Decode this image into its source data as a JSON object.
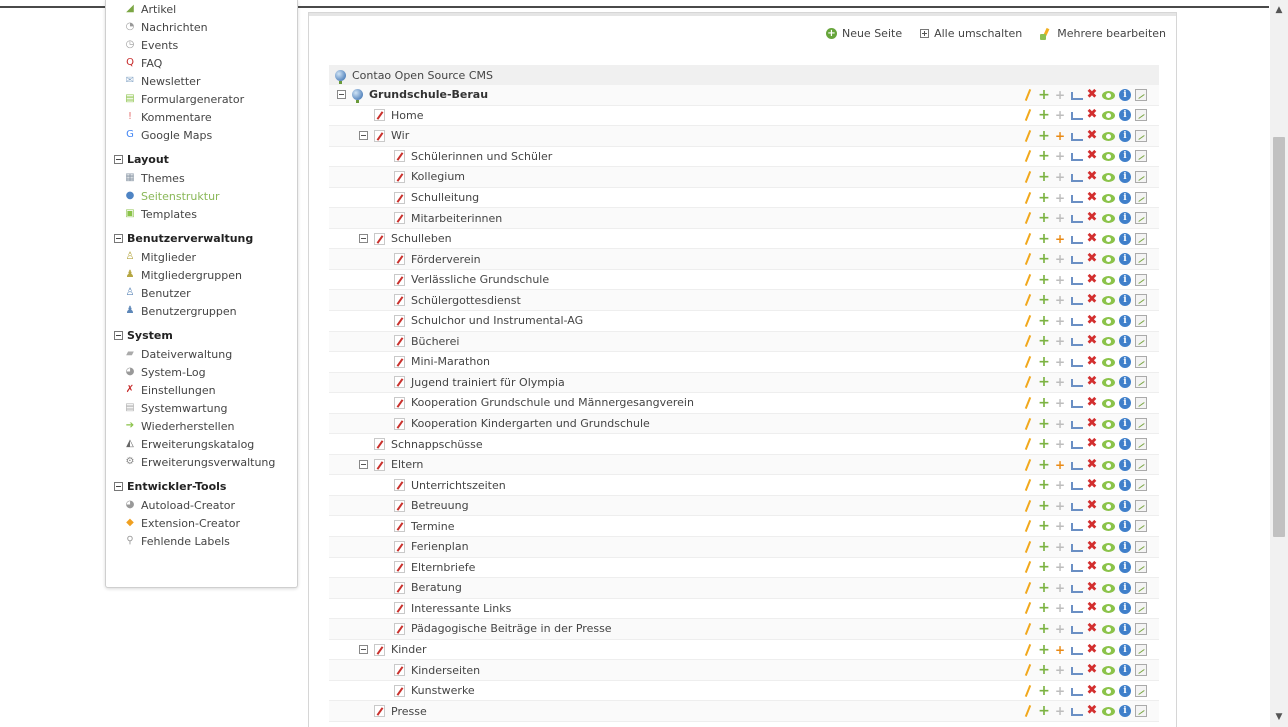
{
  "sidebar": {
    "top_items": [
      {
        "label": "Artikel",
        "icon": "article-icon"
      },
      {
        "label": "Nachrichten",
        "icon": "news-icon"
      },
      {
        "label": "Events",
        "icon": "calendar-icon"
      },
      {
        "label": "FAQ",
        "icon": "faq-icon"
      },
      {
        "label": "Newsletter",
        "icon": "newsletter-icon"
      },
      {
        "label": "Formulargenerator",
        "icon": "form-icon"
      },
      {
        "label": "Kommentare",
        "icon": "comments-icon"
      },
      {
        "label": "Google Maps",
        "icon": "map-icon"
      }
    ],
    "groups": [
      {
        "title": "Layout",
        "items": [
          {
            "label": "Themes",
            "icon": "themes-icon"
          },
          {
            "label": "Seitenstruktur",
            "icon": "globe-icon",
            "active": true
          },
          {
            "label": "Templates",
            "icon": "templates-icon"
          }
        ]
      },
      {
        "title": "Benutzerverwaltung",
        "items": [
          {
            "label": "Mitglieder",
            "icon": "member-icon"
          },
          {
            "label": "Mitgliedergruppen",
            "icon": "member-group-icon"
          },
          {
            "label": "Benutzer",
            "icon": "user-icon"
          },
          {
            "label": "Benutzergruppen",
            "icon": "user-group-icon"
          }
        ]
      },
      {
        "title": "System",
        "items": [
          {
            "label": "Dateiverwaltung",
            "icon": "files-icon"
          },
          {
            "label": "System-Log",
            "icon": "log-icon"
          },
          {
            "label": "Einstellungen",
            "icon": "settings-icon"
          },
          {
            "label": "Systemwartung",
            "icon": "maintenance-icon"
          },
          {
            "label": "Wiederherstellen",
            "icon": "restore-icon"
          },
          {
            "label": "Erweiterungskatalog",
            "icon": "catalog-icon"
          },
          {
            "label": "Erweiterungsverwaltung",
            "icon": "extension-manager-icon"
          }
        ]
      },
      {
        "title": "Entwickler-Tools",
        "items": [
          {
            "label": "Autoload-Creator",
            "icon": "autoload-icon"
          },
          {
            "label": "Extension-Creator",
            "icon": "extension-creator-icon"
          },
          {
            "label": "Fehlende Labels",
            "icon": "search-icon"
          }
        ]
      }
    ]
  },
  "header": {
    "new_page": "Neue Seite",
    "toggle_all": "Alle umschalten",
    "edit_multiple": "Mehrere bearbeiten"
  },
  "tree": {
    "root_label": "Contao Open Source CMS",
    "rows": [
      {
        "label": "Grundschule-Berau",
        "level": 0,
        "toggle": true,
        "bold": true,
        "icon": "globe",
        "paste_orange": false
      },
      {
        "label": "Home",
        "level": 1,
        "toggle": false
      },
      {
        "label": "Wir",
        "level": 1,
        "toggle": true,
        "paste_orange": true
      },
      {
        "label": "Schülerinnen und Schüler",
        "level": 2
      },
      {
        "label": "Kollegium",
        "level": 2
      },
      {
        "label": "Schulleitung",
        "level": 2
      },
      {
        "label": "Mitarbeiterinnen",
        "level": 2
      },
      {
        "label": "Schulleben",
        "level": 1,
        "toggle": true,
        "paste_orange": true
      },
      {
        "label": "Förderverein",
        "level": 2
      },
      {
        "label": "Verlässliche Grundschule",
        "level": 2
      },
      {
        "label": "Schülergottesdienst",
        "level": 2
      },
      {
        "label": "Schulchor und Instrumental-AG",
        "level": 2
      },
      {
        "label": "Bücherei",
        "level": 2
      },
      {
        "label": "Mini-Marathon",
        "level": 2
      },
      {
        "label": "Jugend trainiert für Olympia",
        "level": 2
      },
      {
        "label": "Kooperation Grundschule und Männergesangverein",
        "level": 2
      },
      {
        "label": "Kooperation Kindergarten und Grundschule",
        "level": 2
      },
      {
        "label": "Schnappschüsse",
        "level": 1
      },
      {
        "label": "Eltern",
        "level": 1,
        "toggle": true,
        "paste_orange": true
      },
      {
        "label": "Unterrichtszeiten",
        "level": 2
      },
      {
        "label": "Betreuung",
        "level": 2
      },
      {
        "label": "Termine",
        "level": 2
      },
      {
        "label": "Ferienplan",
        "level": 2
      },
      {
        "label": "Elternbriefe",
        "level": 2
      },
      {
        "label": "Beratung",
        "level": 2
      },
      {
        "label": "Interessante Links",
        "level": 2
      },
      {
        "label": "Pädagogische Beiträge in der Presse",
        "level": 2
      },
      {
        "label": "Kinder",
        "level": 1,
        "toggle": true,
        "paste_orange": true
      },
      {
        "label": "Kinderseiten",
        "level": 2
      },
      {
        "label": "Kunstwerke",
        "level": 2
      },
      {
        "label": "Presse",
        "level": 1
      }
    ]
  }
}
